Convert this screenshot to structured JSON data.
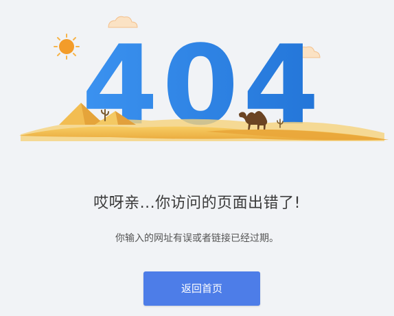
{
  "illustration": {
    "code_text": "404",
    "code_color": "#2f86e8",
    "sand_color": "#f3c14f",
    "sun_color": "#f4a234",
    "icons": [
      "sun-icon",
      "cloud-icon",
      "camel-icon",
      "pyramid-icon",
      "cactus-icon"
    ]
  },
  "message": {
    "title": "哎呀亲...你访问的页面出错了!",
    "subtitle": "你输入的网址有误或者链接已经过期。"
  },
  "actions": {
    "home_label": "返回首页",
    "button_color": "#4d7de8"
  }
}
